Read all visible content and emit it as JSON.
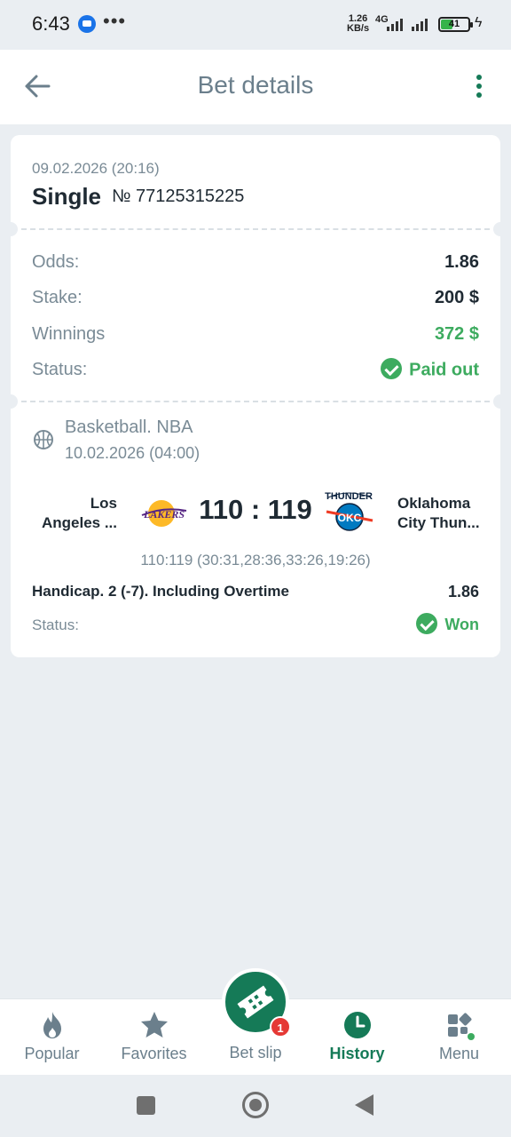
{
  "status_bar": {
    "time": "6:43",
    "dots": "•••",
    "speed_top": "1.26",
    "speed_bottom": "KB/s",
    "network": "4G",
    "battery": "41"
  },
  "header": {
    "title": "Bet details"
  },
  "bet": {
    "date": "09.02.2026 (20:16)",
    "type": "Single",
    "number": "№ 77125315225",
    "odds_label": "Odds:",
    "odds_value": "1.86",
    "stake_label": "Stake:",
    "stake_value": "200 $",
    "winnings_label": "Winnings",
    "winnings_value": "372 $",
    "status_label": "Status:",
    "status_value": "Paid out"
  },
  "event": {
    "sport": "Basketball. NBA",
    "date": "10.02.2026 (04:00)",
    "team1_line1": "Los",
    "team1_line2": "Angeles ...",
    "team2_line1": "Oklahoma",
    "team2_line2": "City Thun...",
    "score": "110 : 119",
    "periods": "110:119 (30:31,28:36,33:26,19:26)",
    "market": "Handicap. 2 (-7). Including Overtime",
    "market_odds": "1.86",
    "status_label": "Status:",
    "status_value": "Won",
    "logo1_text": "LAKERS",
    "logo2_text_top": "THUNDER",
    "logo2_text_mid": "OKC"
  },
  "bottom_nav": {
    "items": [
      {
        "label": "Popular",
        "icon": "flame-icon"
      },
      {
        "label": "Favorites",
        "icon": "star-icon"
      },
      {
        "label": "Bet slip",
        "icon": "ticket-icon",
        "badge": "1"
      },
      {
        "label": "History",
        "icon": "clock-icon",
        "active": true
      },
      {
        "label": "Menu",
        "icon": "grid-icon"
      }
    ]
  },
  "colors": {
    "accent": "#157a57",
    "success": "#3dab5f",
    "muted": "#7a8b96",
    "background": "#eaeef2"
  }
}
